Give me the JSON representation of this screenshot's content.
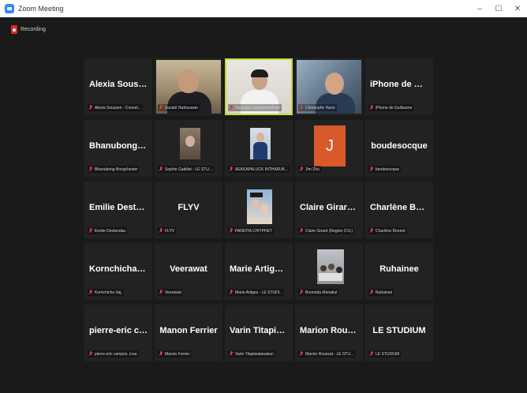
{
  "window": {
    "title": "Zoom Meeting",
    "controls": [
      "–",
      "☐",
      "✕"
    ]
  },
  "recording": {
    "label": "Recording",
    "color": "#e02828"
  },
  "active_speaker_color": "#c7d83a",
  "tiles": [
    {
      "big": "Alexia Soussen...",
      "small": "Alexia Soussen - Cosnet...",
      "video": ""
    },
    {
      "big": "",
      "small": "Surakit Nuthsuwan",
      "video": "office"
    },
    {
      "big": "",
      "small": "Duangjai Tungmuninthum",
      "video": "white",
      "active": true
    },
    {
      "big": "",
      "small": "Christophe Hano",
      "video": "room"
    },
    {
      "big": "iPhone de Guill...",
      "small": "iPhone de Guillaume",
      "video": ""
    },
    {
      "big": "Bhanubong Bo...",
      "small": "Bhanubong Bongchewin",
      "video": ""
    },
    {
      "big": "",
      "small": "Sophie Gabillet - LE STU...",
      "video": "portrait"
    },
    {
      "big": "",
      "small": "AEKKAPALUCK INTHARUK...",
      "video": "suitpic"
    },
    {
      "big": "",
      "small": "Jim Zhu",
      "video": "avatar",
      "avatar_letter": "J"
    },
    {
      "big": "boudesocque",
      "small": "boudesocque",
      "video": ""
    },
    {
      "big": "Emilie Destandau",
      "small": "Emilie Destandau",
      "video": ""
    },
    {
      "big": "FLYV",
      "small": "FLYV",
      "video": ""
    },
    {
      "big": "",
      "small": "PANDITA CHITPHET",
      "video": "grad"
    },
    {
      "big": "Claire Girard (R...",
      "small": "Claire Girard (Region CVL)",
      "video": ""
    },
    {
      "big": "Charlène Bonnet",
      "small": "Charlène Bonnet",
      "video": ""
    },
    {
      "big": "Kornchicha Vaj.",
      "small": "Kornchicha Vaj.",
      "video": ""
    },
    {
      "big": "Veerawat",
      "small": "Veerawat",
      "video": ""
    },
    {
      "big": "Marie Artiges -...",
      "small": "Marie Artiges - LE STUDI...",
      "video": ""
    },
    {
      "big": "",
      "small": "Boonrida Monakul",
      "video": "crowd"
    },
    {
      "big": "Ruhainee",
      "small": "Ruhainee",
      "video": ""
    },
    {
      "big": "pierre-eric cam...",
      "small": "pierre-eric campos, icoa",
      "video": ""
    },
    {
      "big": "Manon Ferrier",
      "small": "Manon Ferrier",
      "video": ""
    },
    {
      "big": "Varin Titapiwat...",
      "small": "Varin Titapiwatanakun",
      "video": ""
    },
    {
      "big": "Marion Roussat...",
      "small": "Marion Roussat - LE STU...",
      "video": ""
    },
    {
      "big": "LE STUDIUM",
      "small": "LE STUDIUM",
      "video": ""
    }
  ]
}
